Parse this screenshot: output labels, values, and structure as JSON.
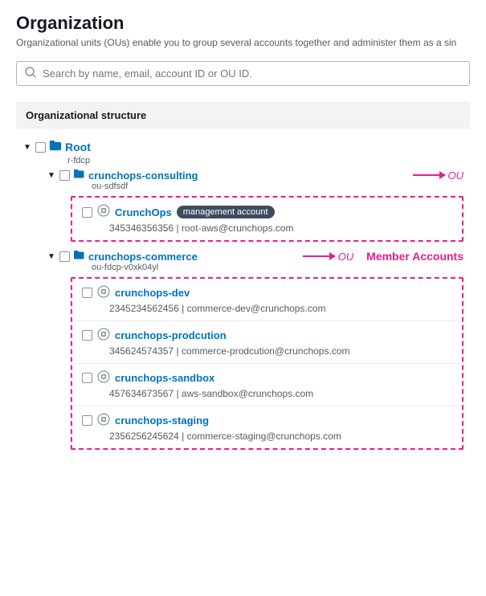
{
  "page": {
    "title": "Organization",
    "description": "Organizational units (OUs) enable you to group several accounts together and administer them as a sin"
  },
  "search": {
    "placeholder": "Search by name, email, account ID or OU ID."
  },
  "section": {
    "label": "Organizational structure"
  },
  "tree": {
    "root": {
      "label": "Root",
      "id": "r-fdcp"
    },
    "ous": [
      {
        "name": "crunchops-consulting",
        "id": "ou-sdfsdf",
        "annotation": "OU",
        "accounts": [
          {
            "name": "CrunchOps",
            "badge": "management account",
            "account_id": "345346356356",
            "email": "root-aws@crunchops.com"
          }
        ]
      },
      {
        "name": "crunchops-commerce",
        "id": "ou-fdcp-v0xk04yl",
        "annotation": "OU",
        "member_accounts_label": "Member Accounts",
        "accounts": [
          {
            "name": "crunchops-dev",
            "account_id": "2345234562456",
            "email": "commerce-dev@crunchops.com"
          },
          {
            "name": "crunchops-prodcution",
            "account_id": "345624574357",
            "email": "commerce-prodcution@crunchops.com"
          },
          {
            "name": "crunchops-sandbox",
            "account_id": "457634673567",
            "email": "aws-sandbox@crunchops.com"
          },
          {
            "name": "crunchops-staging",
            "account_id": "2356256245624",
            "email": "commerce-staging@crunchops.com"
          }
        ]
      }
    ]
  },
  "icons": {
    "search": "🔍",
    "chevron_down": "▼",
    "folder": "📁",
    "account": "⚙"
  }
}
